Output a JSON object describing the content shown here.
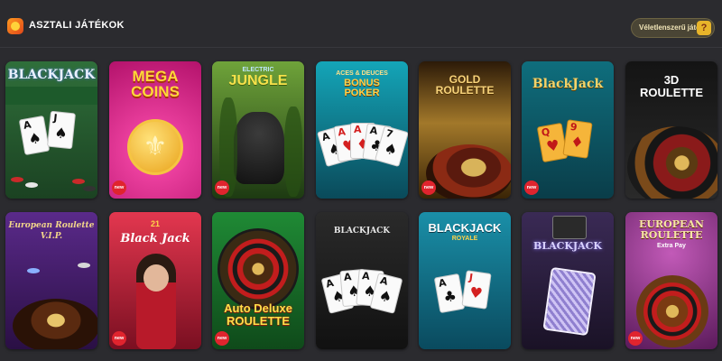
{
  "header": {
    "title": "ASZTALI JÁTÉKOK",
    "logo_icon": "app-logo-icon",
    "random_label": "Véletlenszerű játék",
    "random_icon": "question-gift-icon"
  },
  "colors": {
    "background": "#2b2b2f",
    "new_badge": "#e0242e",
    "random_button": "#4a4535"
  },
  "games": [
    {
      "title": "BLACKJACK",
      "subtitle": "",
      "badge": "",
      "cards": [
        {
          "r": "A",
          "s": "♠"
        },
        {
          "r": "J",
          "s": "♠"
        }
      ]
    },
    {
      "title": "MEGA\nCOINS",
      "subtitle": "",
      "badge": "new",
      "emblem": "fleur-de-lis-coin-icon"
    },
    {
      "title": "JUNGLE",
      "subtitle": "ELECTRIC",
      "badge": "new",
      "emblem": "gorilla-icon"
    },
    {
      "title": "BONUS\nPOKER",
      "subtitle": "ACES & DEUCES",
      "badge": "",
      "cards": [
        {
          "r": "A",
          "s": "♠"
        },
        {
          "r": "A",
          "s": "♥"
        },
        {
          "r": "A",
          "s": "♦"
        },
        {
          "r": "A",
          "s": "♣"
        },
        {
          "r": "7",
          "s": "♠"
        }
      ]
    },
    {
      "title": "GOLD\nROULETTE",
      "subtitle": "",
      "badge": "new",
      "emblem": "roulette-wheel-icon"
    },
    {
      "title": "BlackJack",
      "subtitle": "",
      "badge": "new",
      "cards": [
        {
          "r": "Q",
          "s": "♥"
        },
        {
          "r": "9",
          "s": "♦"
        }
      ]
    },
    {
      "title": "3D\nROULETTE",
      "subtitle": "",
      "badge": "",
      "emblem": "roulette-wheel-icon"
    },
    {
      "title": "European Roulette",
      "subtitle": "V.I.P.",
      "badge": "",
      "emblem": "roulette-wheel-icon"
    },
    {
      "title": "Black Jack",
      "subtitle": "21",
      "badge": "new",
      "emblem": "dealer-icon"
    },
    {
      "title": "Auto Deluxe\nROULETTE",
      "subtitle": "",
      "badge": "new",
      "emblem": "roulette-wheel-icon"
    },
    {
      "title": "BLACKJACK",
      "subtitle": "",
      "badge": "",
      "cards": [
        {
          "r": "A",
          "s": "♠"
        },
        {
          "r": "A",
          "s": "♠"
        },
        {
          "r": "A",
          "s": "♠"
        },
        {
          "r": "A",
          "s": "♠"
        }
      ]
    },
    {
      "title": "BLACKJACK",
      "subtitle": "ROYALE",
      "badge": "",
      "cards": [
        {
          "r": "A",
          "s": "♣"
        },
        {
          "r": "J",
          "s": "♥"
        }
      ]
    },
    {
      "title": "BLACKJACK",
      "subtitle": "",
      "badge": "",
      "emblem": "card-deck-icon"
    },
    {
      "title": "EUROPEAN\nROULETTE",
      "subtitle": "Extra Pay",
      "badge": "new",
      "emblem": "roulette-wheel-icon"
    }
  ]
}
